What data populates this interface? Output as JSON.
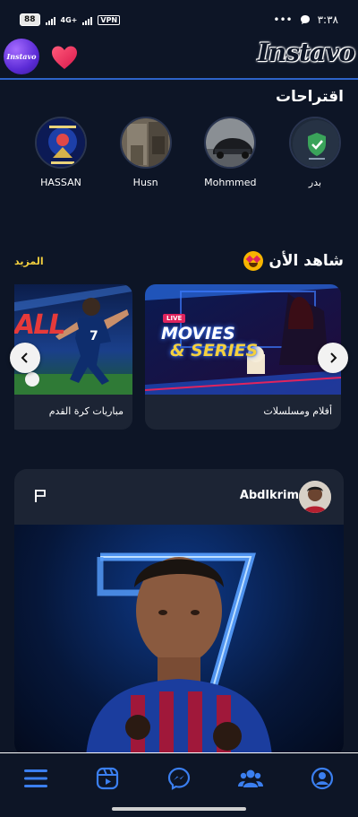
{
  "status_bar": {
    "battery": "88",
    "network": "4G+",
    "vpn": "VPN",
    "more": "•••",
    "time": "٣:٣٨"
  },
  "header": {
    "brand_badge": "Instavo",
    "logo": "Instavo"
  },
  "suggestions": {
    "title": "اقتراحات",
    "items": [
      {
        "name": "بدر"
      },
      {
        "name": "Mohmmed"
      },
      {
        "name": "Husn"
      },
      {
        "name": "HASSAN"
      }
    ]
  },
  "watch_now": {
    "title": "شاهد الأن",
    "more_label": "المزيد",
    "cards": [
      {
        "label": "أفلام ومسلسلات",
        "badge": "LIVE",
        "headline_1": "MOVIES",
        "headline_2": "& SERIES"
      },
      {
        "label": "مباريات كرة القدم",
        "headline": "ALL"
      }
    ]
  },
  "post": {
    "username": "Abdlkrim"
  },
  "colors": {
    "background": "#0d1526",
    "card": "#1c2434",
    "accent_line": "#2d63c9",
    "nav_icon": "#3b7ff0",
    "more_link": "#f4d03f"
  },
  "bottom_nav": [
    "menu-icon",
    "reels-icon",
    "messenger-icon",
    "friends-icon",
    "profile-icon"
  ]
}
